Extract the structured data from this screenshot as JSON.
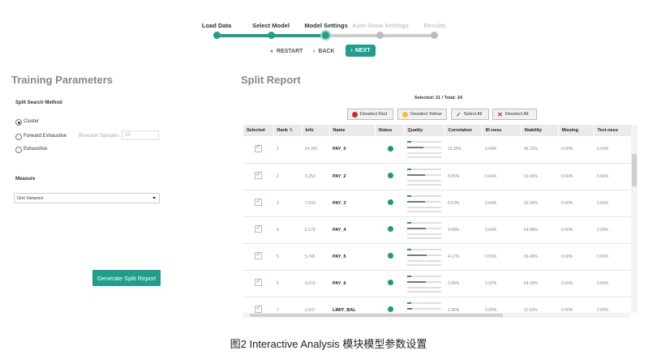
{
  "wizard": {
    "steps": [
      "Load Data",
      "Select Model",
      "Model Settings",
      "Auto Grow Settings",
      "Results"
    ],
    "restart": "RESTART",
    "back": "BACK",
    "next": "NEXT",
    "accent": "#1f9e8c"
  },
  "left": {
    "title": "Training Parameters",
    "split_method_label": "Split Search Method",
    "options": [
      "Cluster",
      "Forward Exhaustive",
      "Exhaustive"
    ],
    "selected_option": "Cluster",
    "bisection_label": "Bisection Samples",
    "bisection_value": "10",
    "measure_label": "Measure",
    "measure_value": "Gini Variance",
    "generate_button": "Generate Split Report"
  },
  "right": {
    "title": "Split Report",
    "selection_summary": "Selected: 21 / Total: 24",
    "buttons": [
      "Deselect Red",
      "Deselect Yellow",
      "Select All",
      "Deselect All"
    ],
    "columns": [
      "Selected",
      "Rank",
      "Info",
      "Name",
      "Status",
      "Quality",
      "Correlation",
      "ID-ness",
      "Stability",
      "Missing",
      "Text-ness"
    ],
    "rows": [
      {
        "rank": "1",
        "info": "14.355",
        "name": "PAY_0",
        "correlation": "15.55%",
        "idness": "0.04%",
        "stability": "45.12%",
        "missing": "0.00%",
        "textness": "0.00%",
        "quality": 0.48
      },
      {
        "rank": "2",
        "info": "9.253",
        "name": "PAY_2",
        "correlation": "8.95%",
        "idness": "0.04%",
        "stability": "52.43%",
        "missing": "0.00%",
        "textness": "0.00%",
        "quality": 0.52
      },
      {
        "rank": "3",
        "info": "7.533",
        "name": "PAY_3",
        "correlation": "6.53%",
        "idness": "0.04%",
        "stability": "52.59%",
        "missing": "0.00%",
        "textness": "0.00%",
        "quality": 0.52
      },
      {
        "rank": "4",
        "info": "6.178",
        "name": "PAY_4",
        "correlation": "4.68%",
        "idness": "0.04%",
        "stability": "54.88%",
        "missing": "0.00%",
        "textness": "0.00%",
        "quality": 0.55
      },
      {
        "rank": "5",
        "info": "5.745",
        "name": "PAY_5",
        "correlation": "4.17%",
        "idness": "0.03%",
        "stability": "56.49%",
        "missing": "0.00%",
        "textness": "0.00%",
        "quality": 0.56
      },
      {
        "rank": "6",
        "info": "4.970",
        "name": "PAY_6",
        "correlation": "3.48%",
        "idness": "0.02%",
        "stability": "54.29%",
        "missing": "0.00%",
        "textness": "0.00%",
        "quality": 0.54
      },
      {
        "rank": "7",
        "info": "2.637",
        "name": "LIMIT_BAL",
        "correlation": "2.36%",
        "idness": "0.00%",
        "stability": "11.22%",
        "missing": "0.00%",
        "textness": "0.00%",
        "quality": 0.15
      }
    ]
  },
  "caption": "图2 Interactive Analysis 模块模型参数设置"
}
